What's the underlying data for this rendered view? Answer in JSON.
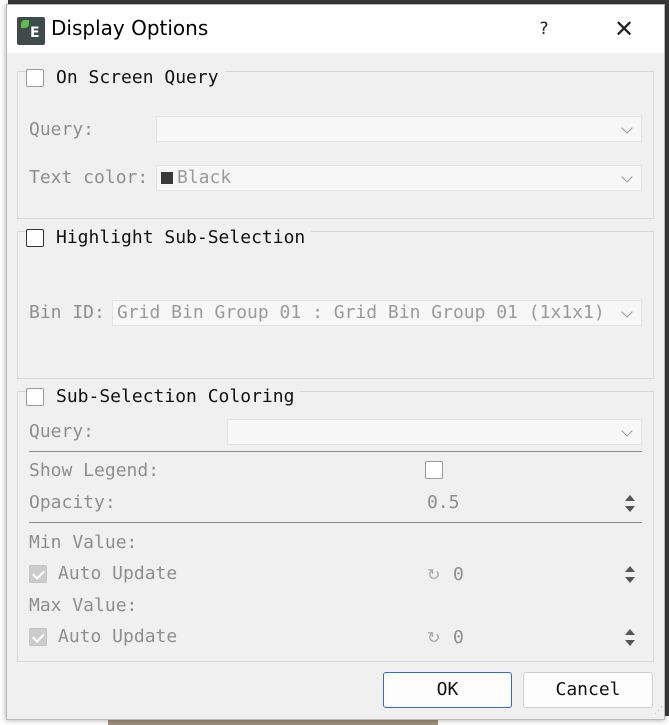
{
  "window": {
    "title": "Display Options",
    "icon_letter": "E",
    "help_label": "?",
    "close_label": "✕"
  },
  "on_screen_query": {
    "title": "On Screen Query",
    "checked": false,
    "query_label": "Query:",
    "query_value": "",
    "text_color_label": "Text color:",
    "text_color_value": "Black",
    "text_color_swatch": "#3a3a3a"
  },
  "highlight_sub_selection": {
    "title": "Highlight Sub-Selection",
    "checked": false,
    "bin_id_label": "Bin ID:",
    "bin_id_value": "Grid Bin Group 01 : Grid Bin Group 01 (1x1x1)"
  },
  "sub_selection_coloring": {
    "title": "Sub-Selection Coloring",
    "checked": false,
    "query_label": "Query:",
    "query_value": "",
    "show_legend_label": "Show Legend:",
    "show_legend_checked": false,
    "opacity_label": "Opacity:",
    "opacity_value": "0.5",
    "min_value_label": "Min Value:",
    "min_auto_update_label": "Auto Update",
    "min_auto_update_checked": true,
    "min_value": "0",
    "max_value_label": "Max Value:",
    "max_auto_update_label": "Auto Update",
    "max_auto_update_checked": true,
    "max_value": "0"
  },
  "buttons": {
    "ok_label": "OK",
    "cancel_label": "Cancel"
  },
  "colors": {
    "accent": "#2a6fd1",
    "dialog_bg": "#f0f0f0",
    "disabled_text": "#8e8e8e"
  }
}
